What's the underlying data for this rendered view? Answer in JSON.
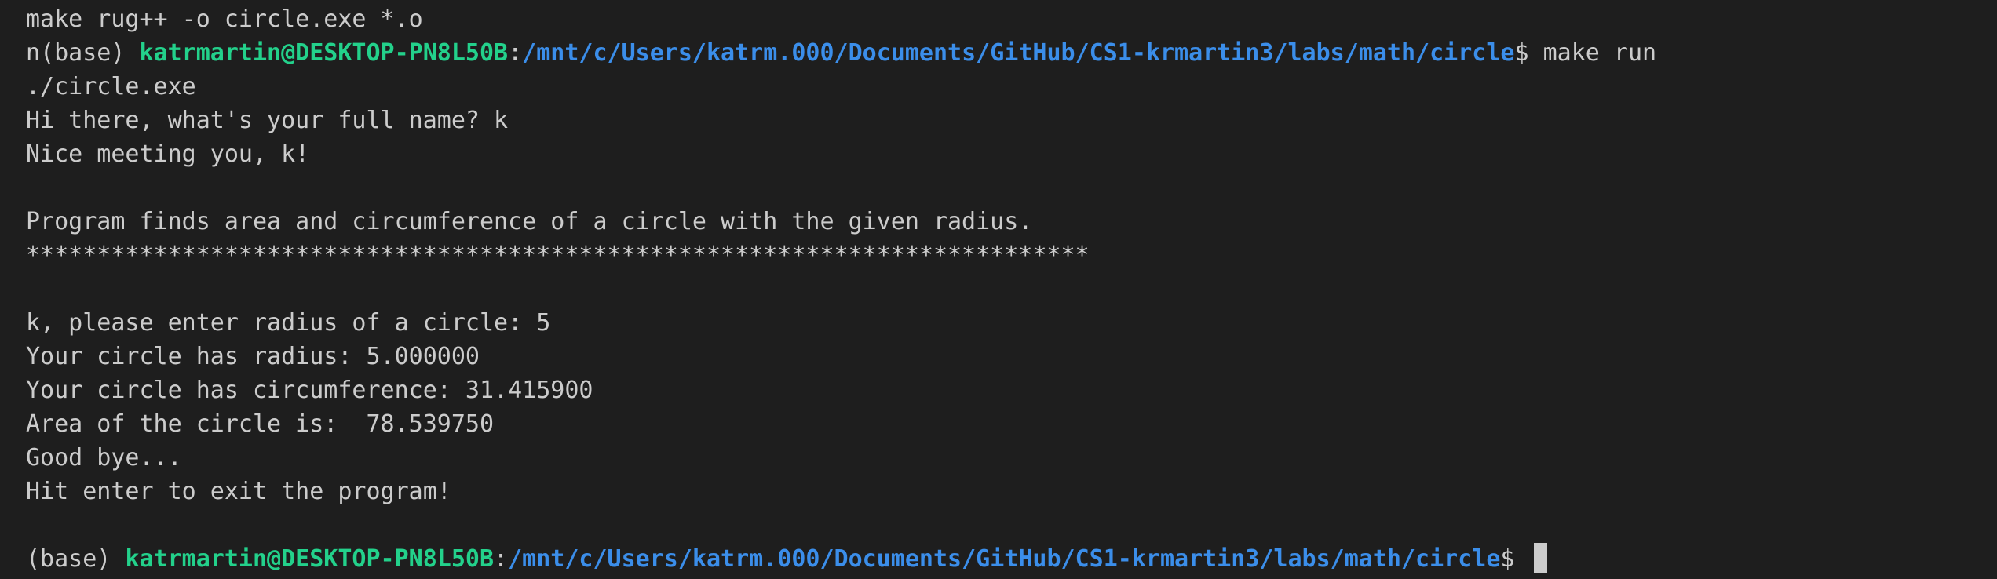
{
  "terminal": {
    "lines": [
      {
        "type": "text",
        "text": "make rug++ -o circle.exe *.o"
      },
      {
        "type": "prompt",
        "prefix": "n(base) ",
        "user": "katrmartin@DESKTOP-PN8L50B",
        "sep": ":",
        "path": "/mnt/c/Users/katrm.000/Documents/GitHub/CS1-krmartin3/labs/math/circle",
        "suffix": "$ make run"
      },
      {
        "type": "text",
        "text": "./circle.exe"
      },
      {
        "type": "text",
        "text": "Hi there, what's your full name? k"
      },
      {
        "type": "text",
        "text": "Nice meeting you, k!"
      },
      {
        "type": "text",
        "text": ""
      },
      {
        "type": "text",
        "text": "Program finds area and circumference of a circle with the given radius."
      },
      {
        "type": "text",
        "text": "***************************************************************************"
      },
      {
        "type": "text",
        "text": ""
      },
      {
        "type": "text",
        "text": "k, please enter radius of a circle: 5"
      },
      {
        "type": "text",
        "text": "Your circle has radius: 5.000000"
      },
      {
        "type": "text",
        "text": "Your circle has circumference: 31.415900"
      },
      {
        "type": "text",
        "text": "Area of the circle is:  78.539750"
      },
      {
        "type": "text",
        "text": "Good bye..."
      },
      {
        "type": "text",
        "text": "Hit enter to exit the program!"
      },
      {
        "type": "text",
        "text": ""
      },
      {
        "type": "prompt",
        "prefix": "(base) ",
        "user": "katrmartin@DESKTOP-PN8L50B",
        "sep": ":",
        "path": "/mnt/c/Users/katrm.000/Documents/GitHub/CS1-krmartin3/labs/math/circle",
        "suffix": "$ ",
        "cursor": true
      }
    ]
  },
  "colors": {
    "background": "#1e1e1e",
    "text": "#cccccc",
    "user": "#23d18b",
    "path": "#3b8eea"
  }
}
